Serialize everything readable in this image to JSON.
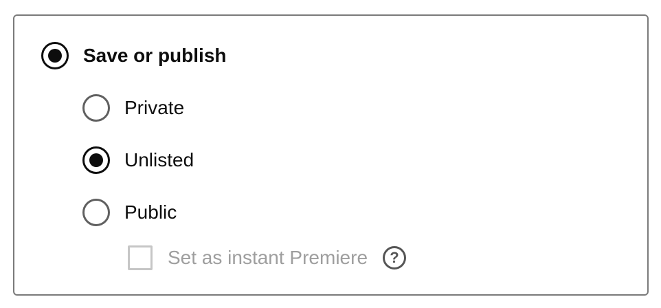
{
  "visibility": {
    "main_option": {
      "label": "Save or publish",
      "selected": true
    },
    "options": [
      {
        "label": "Private",
        "selected": false
      },
      {
        "label": "Unlisted",
        "selected": true
      },
      {
        "label": "Public",
        "selected": false
      }
    ],
    "premiere": {
      "label": "Set as instant Premiere",
      "checked": false,
      "disabled": true,
      "help_glyph": "?"
    }
  },
  "colors": {
    "selected": "#0d0d0d",
    "unselected_radio": "#606060",
    "disabled_text": "#9e9e9e",
    "disabled_checkbox": "#c6c6c6",
    "panel_border": "#7a7a7a"
  },
  "icons": {
    "help": "help-circle-icon"
  }
}
